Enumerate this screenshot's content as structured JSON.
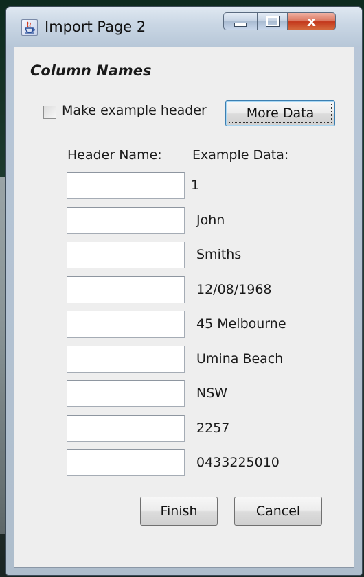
{
  "window": {
    "title": "Import Page 2",
    "close_glyph": "x"
  },
  "section": {
    "title": "Column Names"
  },
  "options": {
    "make_header_label": "Make example header",
    "make_header_checked": false,
    "more_data_label": "More Data"
  },
  "columns": {
    "header_name": "Header Name:",
    "example_data": "Example Data:"
  },
  "rows": [
    {
      "header_value": "",
      "example": "1"
    },
    {
      "header_value": "",
      "example": "John"
    },
    {
      "header_value": "",
      "example": "Smiths"
    },
    {
      "header_value": "",
      "example": "12/08/1968"
    },
    {
      "header_value": "",
      "example": "45 Melbourne"
    },
    {
      "header_value": "",
      "example": "Umina Beach"
    },
    {
      "header_value": "",
      "example": "NSW"
    },
    {
      "header_value": "",
      "example": "2257"
    },
    {
      "header_value": "",
      "example": "0433225010"
    }
  ],
  "actions": {
    "finish_label": "Finish",
    "cancel_label": "Cancel"
  },
  "colors": {
    "client_background": "#eeeeee",
    "close_button": "#c3371c",
    "focus_border": "#3c7fb1"
  },
  "icons": {
    "app_icon": "java-app-icon",
    "minimize": "minimize-icon",
    "maximize": "maximize-icon",
    "close": "close-icon"
  }
}
